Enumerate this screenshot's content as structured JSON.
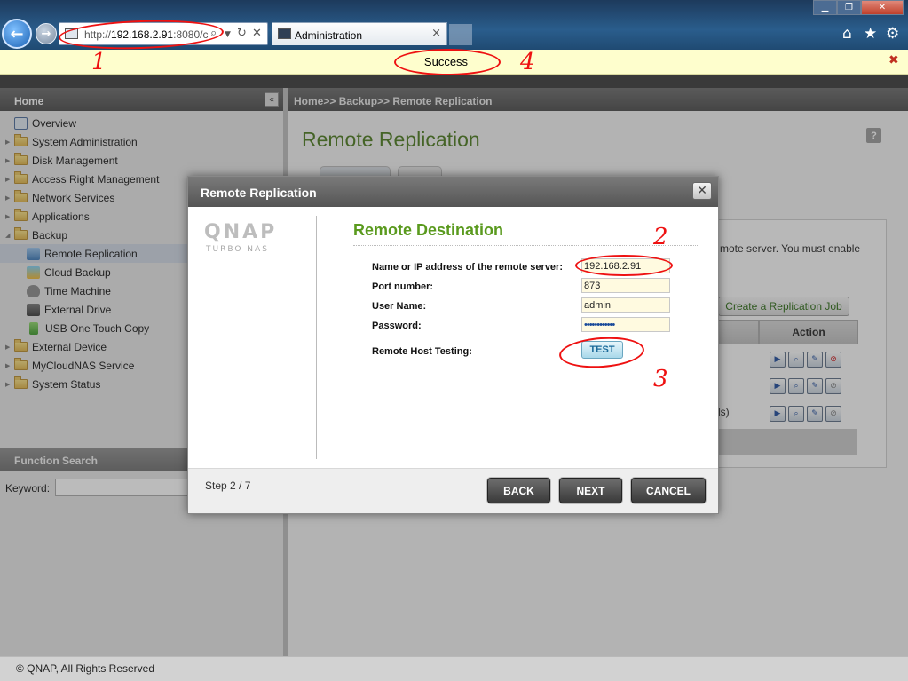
{
  "browser": {
    "url_prefix": "http://",
    "url_host": "192.168.2.91",
    "url_suffix": ":8080/c",
    "tab_title": "Administration",
    "tab_close": "×",
    "icons": [
      "back-icon",
      "forward-icon",
      "search-icon",
      "refresh-icon",
      "stop-icon",
      "home-icon",
      "favorites-icon",
      "tools-icon"
    ]
  },
  "notification": {
    "text": "Success",
    "close": "✖"
  },
  "sidebar": {
    "home_label": "Home",
    "items": [
      {
        "label": "Overview"
      },
      {
        "label": "System Administration"
      },
      {
        "label": "Disk Management"
      },
      {
        "label": "Access Right Management"
      },
      {
        "label": "Network Services"
      },
      {
        "label": "Applications"
      },
      {
        "label": "Backup"
      },
      {
        "label": "Remote Replication"
      },
      {
        "label": "Cloud Backup"
      },
      {
        "label": "Time Machine"
      },
      {
        "label": "External Drive"
      },
      {
        "label": "USB One Touch Copy"
      },
      {
        "label": "External Device"
      },
      {
        "label": "MyCloudNAS Service"
      },
      {
        "label": "System Status"
      }
    ],
    "function_search_label": "Function Search",
    "keyword_label": "Keyword:"
  },
  "main": {
    "breadcrumb": "Home>> Backup>> Remote Replication",
    "page_title": "Remote Replication",
    "help": "?",
    "bg_text": "mote server. You must enable",
    "create_job_label": "Create a Replication Job",
    "action_header": "Action",
    "partial_text": "ls)"
  },
  "modal": {
    "title": "Remote Replication",
    "close": "✕",
    "logo": "QNAP",
    "logo_sub": "Turbo NAS",
    "section_title": "Remote Destination",
    "fields": {
      "host_label": "Name or IP address of the remote server:",
      "host_value": "192.168.2.91",
      "port_label": "Port number:",
      "port_value": "873",
      "user_label": "User Name:",
      "user_value": "admin",
      "password_label": "Password:",
      "password_value": "••••••••••••",
      "test_label": "Remote Host Testing:",
      "test_button": "TEST"
    },
    "step": "Step 2 / 7",
    "back": "BACK",
    "next": "NEXT",
    "cancel": "CANCEL"
  },
  "footer": {
    "copyright": "© QNAP, All Rights Reserved"
  },
  "annotations": [
    "1",
    "2",
    "3",
    "4"
  ],
  "colors": {
    "accent_green": "#5a9a1e",
    "annotation_red": "#e11111",
    "notification_bg": "#fefecd"
  }
}
